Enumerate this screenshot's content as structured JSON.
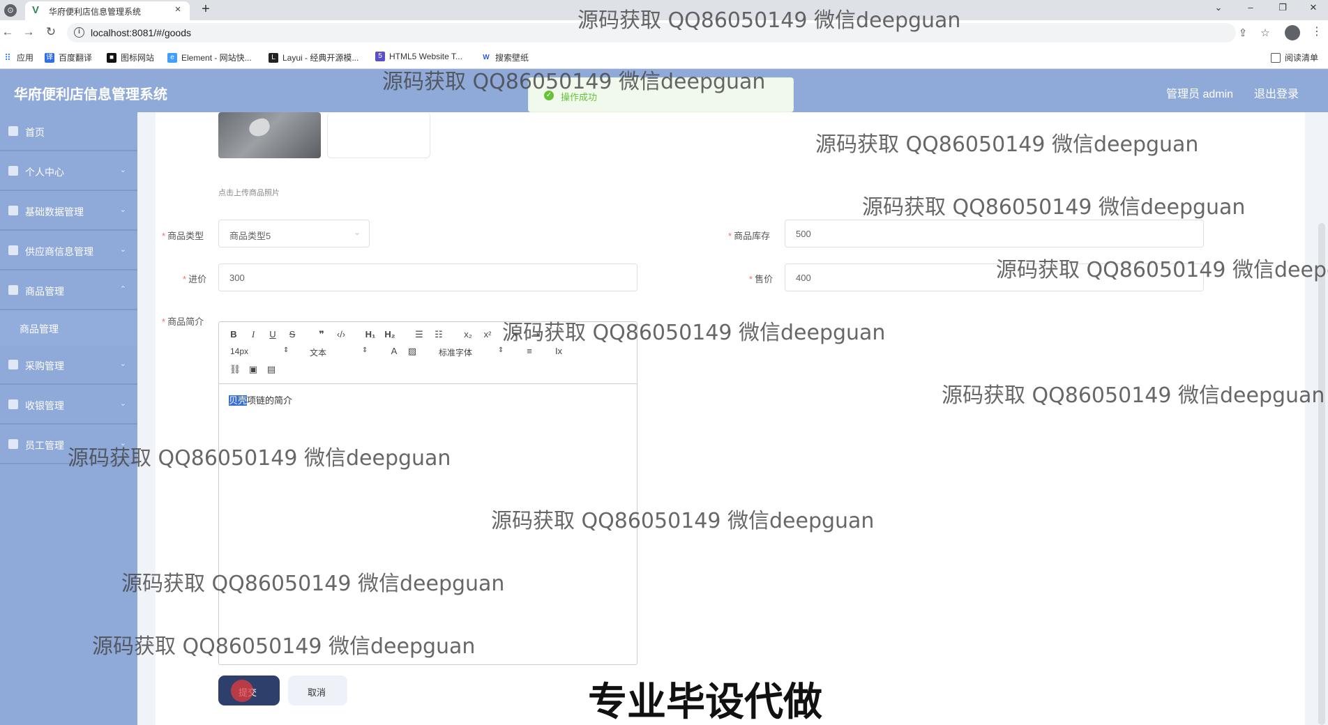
{
  "browser": {
    "tab_title": "华府便利店信息管理系统",
    "url": "localhost:8081/#/goods",
    "bookmarks": [
      {
        "label": "应用",
        "icon": "apps-grid-icon"
      },
      {
        "label": "百度翻译",
        "icon": "baidu-translate-icon",
        "color": "#2f6fe4"
      },
      {
        "label": "图标网站",
        "icon": "iconfont-icon",
        "color": "#111111"
      },
      {
        "label": "Element - 网站快...",
        "icon": "element-icon",
        "color": "#409eff"
      },
      {
        "label": "Layui - 经典开源模...",
        "icon": "layui-icon",
        "color": "#222222"
      },
      {
        "label": "HTML5 Website T...",
        "icon": "html5-icon",
        "color": "#5b4fc7"
      },
      {
        "label": "搜索壁纸",
        "icon": "wallpaper-icon",
        "color": "#2b5bd6"
      }
    ],
    "reading_list": "阅读清单"
  },
  "app": {
    "title": "华府便利店信息管理系统",
    "user_label": "管理员 admin",
    "logout_label": "退出登录",
    "header_color": "#8fa9d9"
  },
  "toast": {
    "message": "操作成功",
    "color": "#67c23a"
  },
  "sidebar": {
    "items": [
      {
        "label": "首页"
      },
      {
        "label": "个人中心"
      },
      {
        "label": "基础数据管理"
      },
      {
        "label": "供应商信息管理"
      },
      {
        "label": "商品管理"
      },
      {
        "label": "商品管理"
      },
      {
        "label": "采购管理"
      },
      {
        "label": "收银管理"
      },
      {
        "label": "员工管理"
      }
    ]
  },
  "form": {
    "upload_tip": "点击上传商品照片",
    "goods_type": {
      "label": "商品类型",
      "value": "商品类型5"
    },
    "stock": {
      "label": "商品库存",
      "value": "500"
    },
    "cost_price": {
      "label": "进价",
      "value": "300"
    },
    "sale_price": {
      "label": "售价",
      "value": "400"
    },
    "intro": {
      "label": "商品简介",
      "font_size": "14px",
      "text_style": "文本",
      "font_family": "标准字体",
      "content_selected": "贝壳",
      "content_rest": "项链的简介"
    },
    "submit_label": "提交",
    "cancel_label": "取消"
  },
  "overlay": {
    "watermark": "源码获取 QQ86050149 微信deepguan",
    "caption": "专业毕设代做"
  }
}
